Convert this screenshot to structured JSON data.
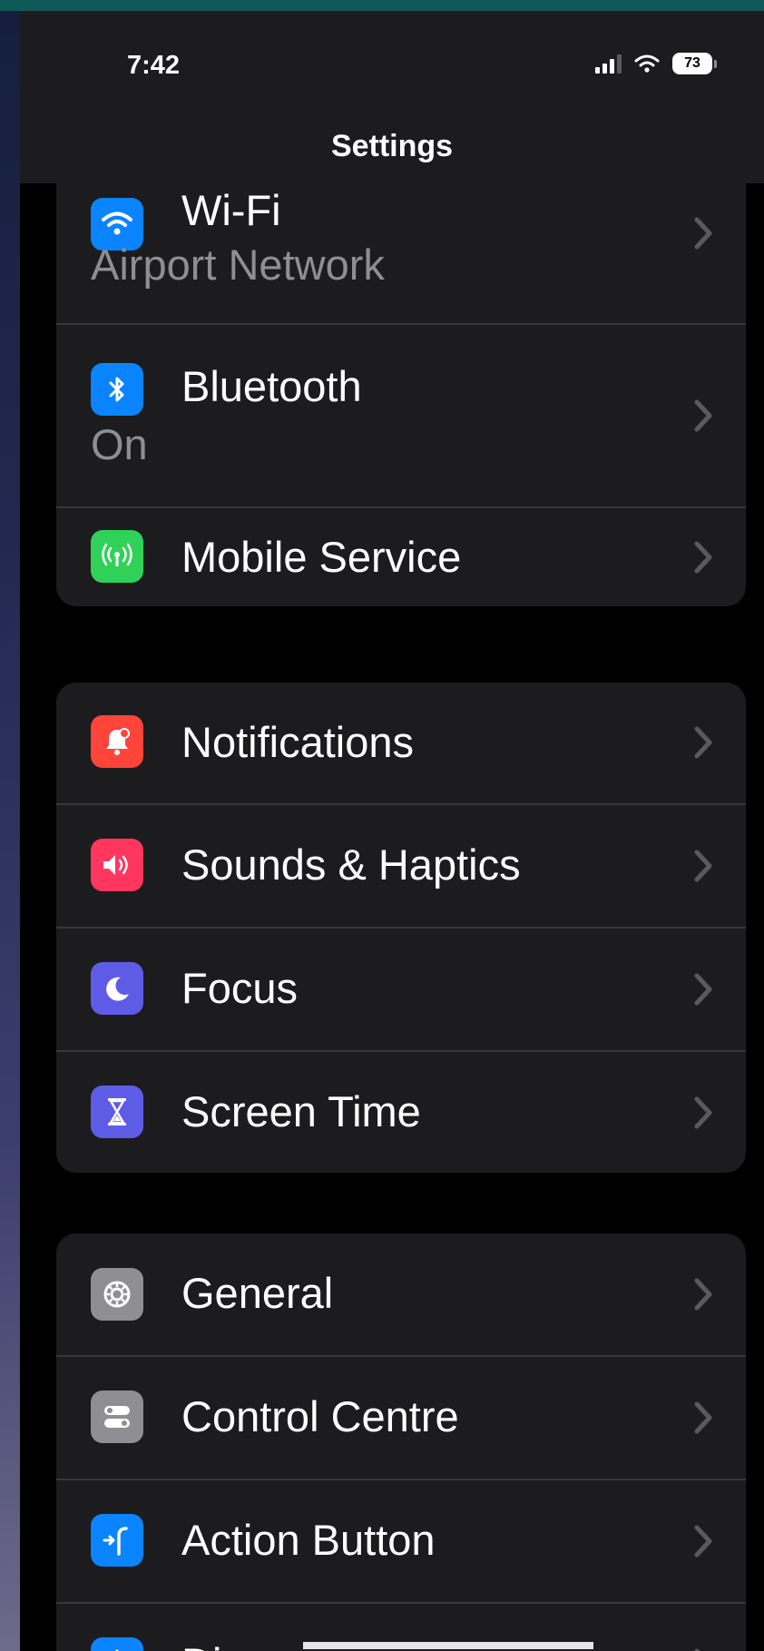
{
  "status_bar": {
    "time": "7:42",
    "battery": "73"
  },
  "nav": {
    "title": "Settings"
  },
  "groups": [
    {
      "items": [
        {
          "label": "Wi-Fi",
          "subtitle": "Airport Network",
          "icon": "wifi-icon",
          "color": "#0a84ff"
        },
        {
          "label": "Bluetooth",
          "subtitle": "On",
          "icon": "bluetooth-icon",
          "color": "#0a84ff"
        },
        {
          "label": "Mobile Service",
          "icon": "antenna-icon",
          "color": "#30d158"
        }
      ]
    },
    {
      "items": [
        {
          "label": "Notifications",
          "icon": "bell-icon",
          "color": "#ff453a"
        },
        {
          "label": "Sounds & Haptics",
          "icon": "speaker-icon",
          "color": "#ff375f"
        },
        {
          "label": "Focus",
          "icon": "moon-icon",
          "color": "#5e5ce6"
        },
        {
          "label": "Screen Time",
          "icon": "hourglass-icon",
          "color": "#5e5ce6"
        }
      ]
    },
    {
      "items": [
        {
          "label": "General",
          "icon": "gear-icon",
          "color": "#8e8e93"
        },
        {
          "label": "Control Centre",
          "icon": "toggles-icon",
          "color": "#8e8e93"
        },
        {
          "label": "Action Button",
          "icon": "action-button-icon",
          "color": "#0a84ff"
        },
        {
          "label": "Di",
          "icon": "display-icon",
          "color": "#0a84ff"
        }
      ]
    }
  ]
}
